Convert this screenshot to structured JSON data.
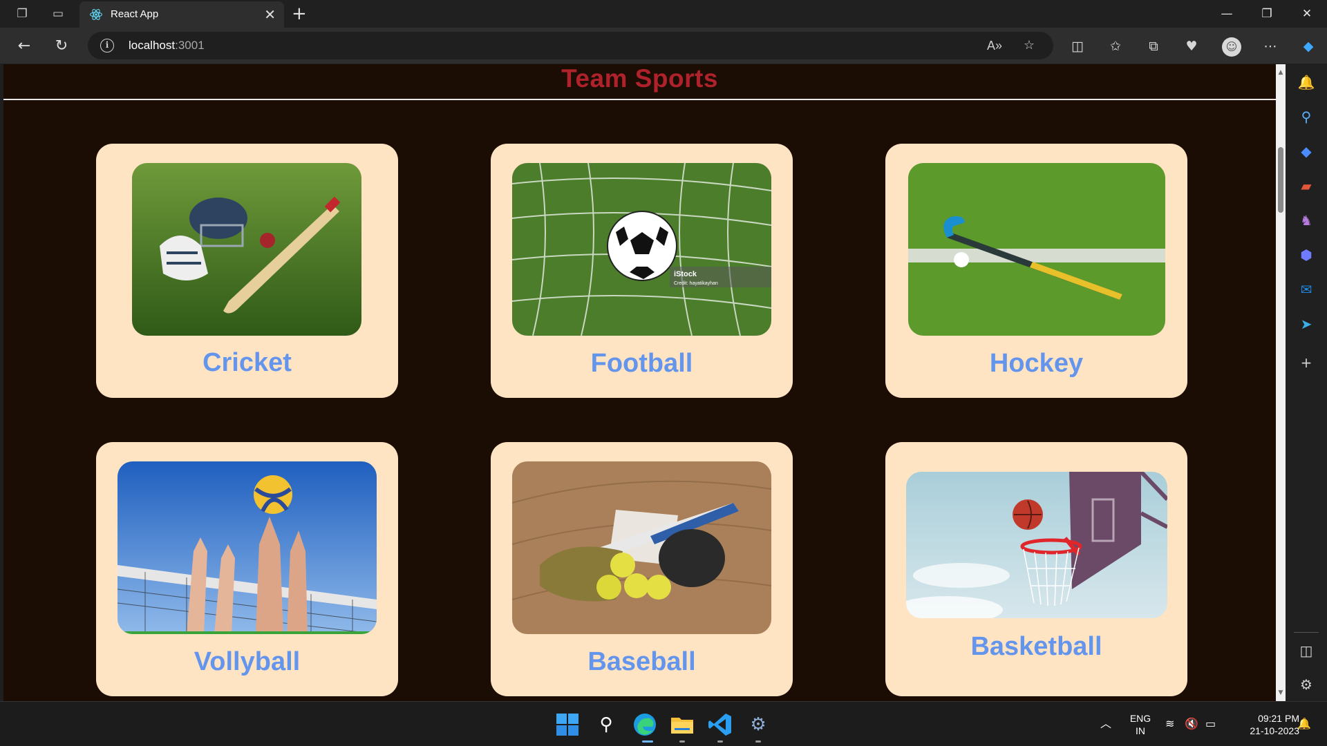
{
  "browser": {
    "tab_title": "React App",
    "url_host": "localhost",
    "url_port": ":3001"
  },
  "page": {
    "title": "Team Sports",
    "cards": [
      {
        "name": "Cricket"
      },
      {
        "name": "Football"
      },
      {
        "name": "Hockey"
      },
      {
        "name": "Vollyball"
      },
      {
        "name": "Baseball"
      },
      {
        "name": "Basketball"
      }
    ],
    "watermark": {
      "brand": "iStock",
      "credit": "Credit: hayatikayhan"
    }
  },
  "taskbar": {
    "language_line1": "ENG",
    "language_line2": "IN",
    "time": "09:21 PM",
    "date": "21-10-2023"
  },
  "colors": {
    "page_bg": "#1b0d03",
    "title": "#b0222b",
    "card_bg": "#ffe4c4",
    "card_label": "#6495ed"
  },
  "icons": {
    "titlebar": [
      "workspaces-icon",
      "tab-actions-icon"
    ],
    "nav": [
      "back-icon",
      "refresh-icon",
      "info-icon"
    ],
    "toolbar": [
      "read-aloud-icon",
      "favorite-star-icon",
      "split-screen-icon",
      "favorites-icon",
      "collections-icon",
      "browser-essentials-icon",
      "profile-icon",
      "more-icon",
      "copilot-icon"
    ],
    "sidebar": [
      "notifications-icon",
      "search-icon",
      "shopping-icon",
      "tools-icon",
      "games-icon",
      "microsoft-365-icon",
      "outlook-icon",
      "telegram-icon",
      "add-icon",
      "sidebar-toggle-icon",
      "settings-icon"
    ],
    "taskbar": [
      "windows-start-icon",
      "search-icon",
      "edge-icon",
      "file-explorer-icon",
      "vscode-icon",
      "settings-icon"
    ]
  }
}
